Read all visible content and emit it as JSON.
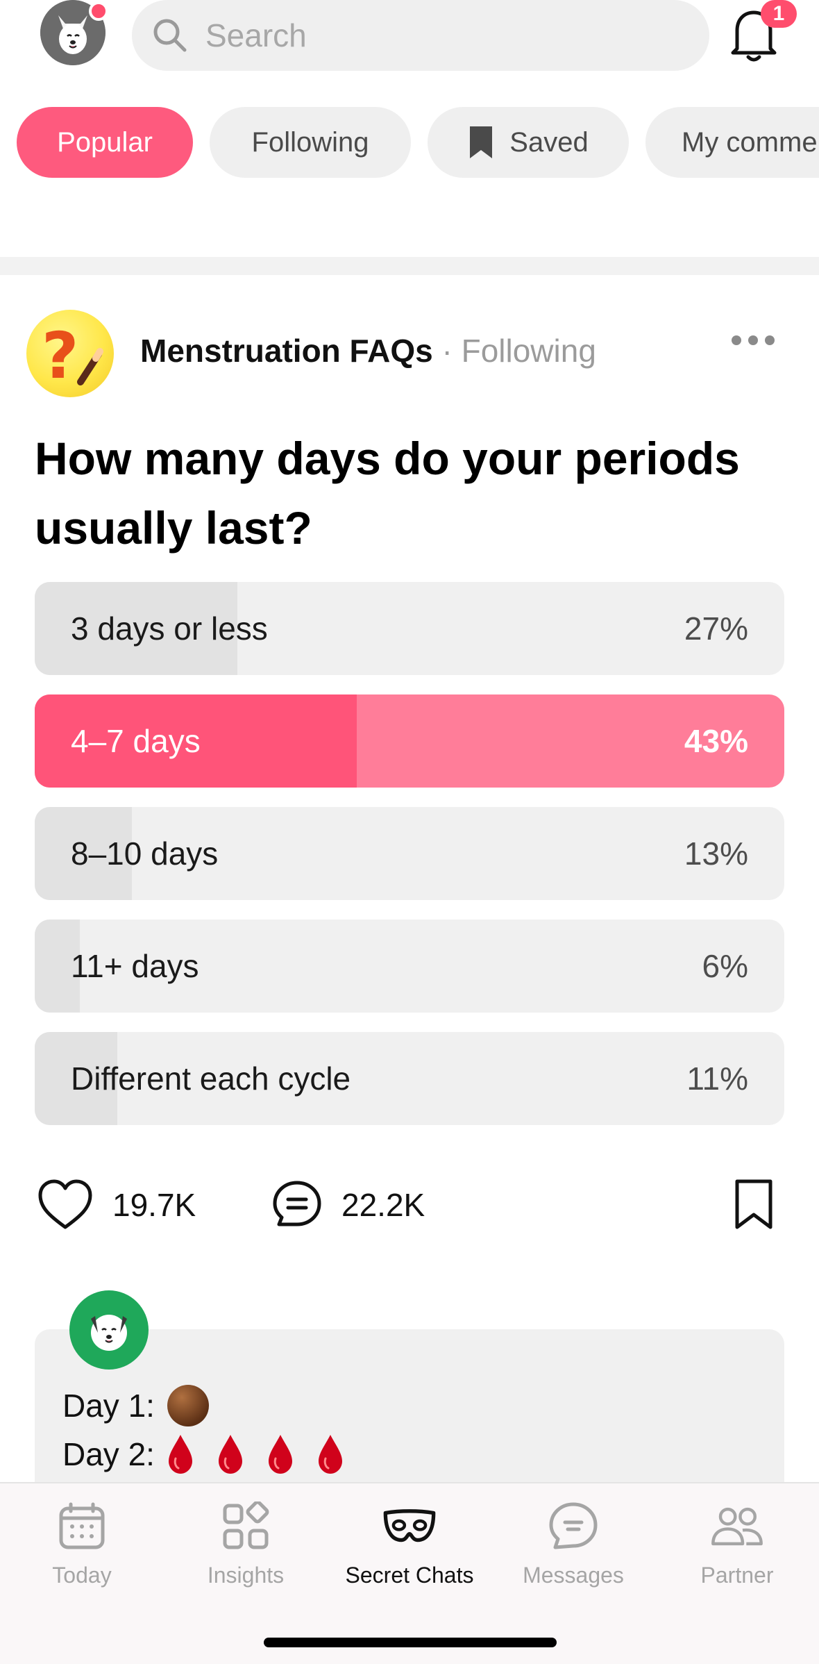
{
  "header": {
    "search_placeholder": "Search",
    "notification_count": "1"
  },
  "chips": [
    {
      "label": "Popular",
      "active": true
    },
    {
      "label": "Following",
      "active": false
    },
    {
      "label": "Saved",
      "active": false
    },
    {
      "label": "My comme",
      "active": false
    }
  ],
  "post": {
    "author": "Menstruation FAQs",
    "follow_status": "· Following",
    "question": "How many days do your periods usually last?",
    "poll": [
      {
        "label": "3 days or less",
        "percent": "27%",
        "fraction": 0.27,
        "selected": false
      },
      {
        "label": "4–7 days",
        "percent": "43%",
        "fraction": 0.43,
        "selected": true
      },
      {
        "label": "8–10 days",
        "percent": "13%",
        "fraction": 0.13,
        "selected": false
      },
      {
        "label": "11+ days",
        "percent": "6%",
        "fraction": 0.06,
        "selected": false
      },
      {
        "label": "Different each cycle",
        "percent": "11%",
        "fraction": 0.11,
        "selected": false
      }
    ],
    "likes": "19.7K",
    "comments": "22.2K"
  },
  "comment_preview": {
    "lines": [
      {
        "label": "Day 1:",
        "drops": 0,
        "circle": true
      },
      {
        "label": "Day 2:",
        "drops": 4,
        "circle": false
      }
    ]
  },
  "tabbar": {
    "items": [
      {
        "label": "Today",
        "icon": "calendar-icon",
        "active": false
      },
      {
        "label": "Insights",
        "icon": "insights-grid-icon",
        "active": false
      },
      {
        "label": "Secret Chats",
        "icon": "mask-icon",
        "active": true
      },
      {
        "label": "Messages",
        "icon": "message-bubble-icon",
        "active": false
      },
      {
        "label": "Partner",
        "icon": "partner-icon",
        "active": false
      }
    ]
  },
  "colors": {
    "accent": "#fe5a7e",
    "selected_fill": "#ff5479",
    "selected_bg": "#ff7d99",
    "badge": "#ff4d6d"
  }
}
